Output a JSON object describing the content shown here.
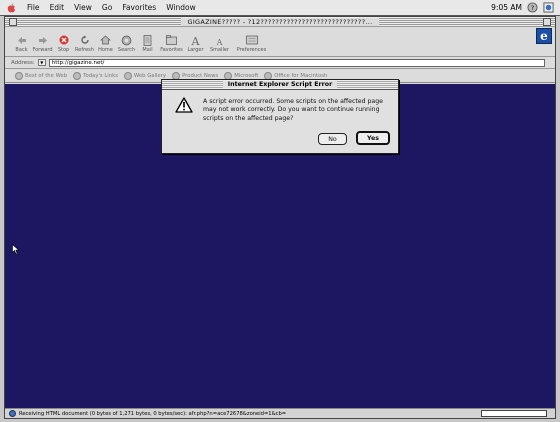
{
  "menubar": {
    "items": [
      "File",
      "Edit",
      "View",
      "Go",
      "Favorites",
      "Window"
    ],
    "clock": "9:05 AM"
  },
  "window": {
    "title": "GIGAZINE????? - ?12????????????????????????????...",
    "toolbar": {
      "buttons": [
        {
          "label": "Back",
          "icon": "back-arrow-icon"
        },
        {
          "label": "Forward",
          "icon": "forward-arrow-icon"
        },
        {
          "label": "Stop",
          "icon": "stop-icon"
        },
        {
          "label": "Refresh",
          "icon": "refresh-icon"
        },
        {
          "label": "Home",
          "icon": "home-icon"
        },
        {
          "label": "Search",
          "icon": "search-icon"
        },
        {
          "label": "Mail",
          "icon": "mail-icon"
        },
        {
          "label": "Favorites",
          "icon": "favorites-icon"
        },
        {
          "label": "Larger",
          "icon": "larger-text-icon"
        },
        {
          "label": "Smaller",
          "icon": "smaller-text-icon"
        },
        {
          "label": "Preferences",
          "icon": "preferences-icon"
        }
      ]
    },
    "address": {
      "label": "Address:",
      "value": "http://gigazine.net/"
    },
    "favorites_bar": [
      "Best of the Web",
      "Today's Links",
      "Web Gallery",
      "Product News",
      "Microsoft",
      "Office for Macintosh"
    ],
    "status": {
      "text": "Receiving HTML document (0 bytes of 1,271 bytes, 0 bytes/sec): afr.php?n=ace72678&zoneid=1&cb=",
      "progress": 0.0
    }
  },
  "dialog": {
    "title": "Internet Explorer Script Error",
    "message": "A script error occurred. Some scripts on the affected page may not work correctly. Do you want to continue running scripts on the affected page?",
    "no_label": "No",
    "yes_label": "Yes",
    "icon": "warning-icon"
  },
  "colors": {
    "page_background": "#1c1760"
  }
}
